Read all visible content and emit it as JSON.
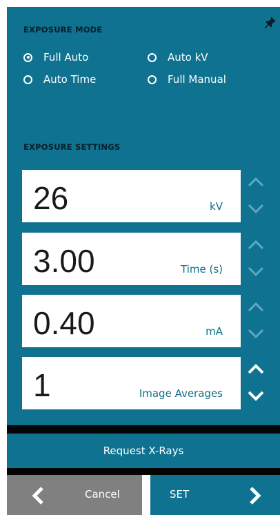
{
  "exposure_mode": {
    "title": "EXPOSURE MODE",
    "options": [
      {
        "label": "Full Auto",
        "checked": true
      },
      {
        "label": "Auto kV",
        "checked": false
      },
      {
        "label": "Auto Time",
        "checked": false
      },
      {
        "label": "Full Manual",
        "checked": false
      }
    ]
  },
  "exposure_settings": {
    "title": "EXPOSURE SETTINGS",
    "fields": [
      {
        "value": "26",
        "unit": "kV"
      },
      {
        "value": "3.00",
        "unit": "Time (s)"
      },
      {
        "value": "0.40",
        "unit": "mA"
      },
      {
        "value": "1",
        "unit": "Image Averages"
      }
    ]
  },
  "request_label": "Request X-Rays",
  "cancel_label": "Cancel",
  "set_label": "SET",
  "icons": {
    "pin": "pin-icon",
    "increase": "chevron-up-icon",
    "decrease": "chevron-down-icon",
    "back": "chevron-left-icon",
    "forward": "chevron-right-icon"
  },
  "colors": {
    "panel": "#0e7290",
    "title_text": "#0b1e2a",
    "stepper_disabled": "#5fa9c0",
    "stepper_enabled": "#ffffff",
    "cancel_bg": "#808080"
  }
}
